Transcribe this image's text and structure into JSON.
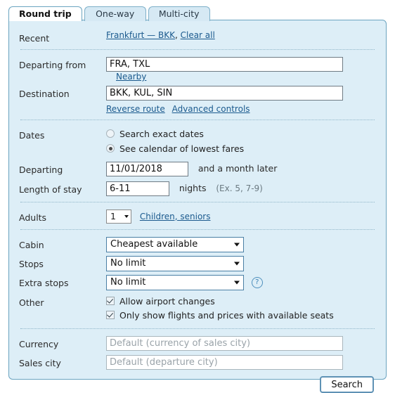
{
  "tabs": [
    {
      "label": "Round trip",
      "active": true
    },
    {
      "label": "One-way",
      "active": false
    },
    {
      "label": "Multi-city",
      "active": false
    }
  ],
  "recent": {
    "label": "Recent",
    "items": "Frankfurt — BKK",
    "separator": ",",
    "clear_all": "Clear all"
  },
  "route": {
    "departing_label": "Departing from",
    "departing_value": "FRA, TXL",
    "nearby_link": "Nearby",
    "destination_label": "Destination",
    "destination_value": "BKK, KUL, SIN",
    "reverse_route_link": "Reverse route",
    "advanced_controls_link": "Advanced controls"
  },
  "dates": {
    "label": "Dates",
    "option_exact": "Search exact dates",
    "option_calendar": "See calendar of lowest fares",
    "selected_option": "calendar",
    "departing_label": "Departing",
    "departing_value": "11/01/2018",
    "departing_note": "and a month later",
    "stay_label": "Length of stay",
    "stay_value": "6-11",
    "stay_unit": "nights",
    "stay_example": "(Ex. 5, 7-9)"
  },
  "passengers": {
    "adults_label": "Adults",
    "adults_value": "1",
    "children_link": "Children, seniors"
  },
  "options": {
    "cabin_label": "Cabin",
    "cabin_value": "Cheapest available",
    "stops_label": "Stops",
    "stops_value": "No limit",
    "extra_stops_label": "Extra stops",
    "extra_stops_value": "No limit",
    "help_icon": "question-mark",
    "other_label": "Other",
    "check_airport_changes": "Allow airport changes",
    "check_available_seats": "Only show flights and prices with available seats",
    "airport_changes_checked": true,
    "available_seats_checked": true
  },
  "locale": {
    "currency_label": "Currency",
    "currency_placeholder": "Default (currency of sales city)",
    "currency_value": "",
    "sales_city_label": "Sales city",
    "sales_city_placeholder": "Default (departure city)",
    "sales_city_value": ""
  },
  "actions": {
    "search_button": "Search"
  },
  "colors": {
    "panel_background": "#ddeef7",
    "panel_border": "#6ba4c0",
    "tab_inactive": "#d6e9f4",
    "tab_active": "#ffffff",
    "link": "#1b5a8e",
    "select_border": "#4a7fa5",
    "button_border": "#5f92b5"
  }
}
